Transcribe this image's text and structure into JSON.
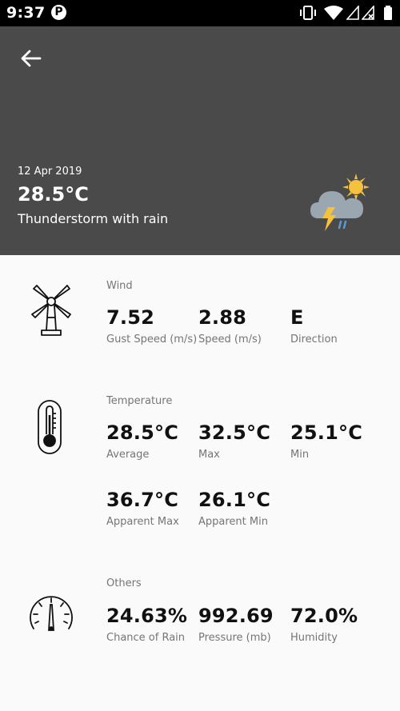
{
  "status_bar": {
    "time": "9:37",
    "app_icon_letter": "P"
  },
  "header": {
    "date": "12 Apr 2019",
    "temperature": "28.5°C",
    "description": "Thunderstorm with rain",
    "weather_icon": "thunderstorm-rain-sun-icon",
    "background_color": "#4a4a4a"
  },
  "wind": {
    "title": "Wind",
    "icon": "windmill-icon",
    "stats": [
      {
        "value": "7.52",
        "label": "Gust Speed (m/s)"
      },
      {
        "value": "2.88",
        "label": "Speed (m/s)"
      },
      {
        "value": "E",
        "label": "Direction"
      }
    ]
  },
  "temperature": {
    "title": "Temperature",
    "icon": "thermometer-icon",
    "stats": [
      {
        "value": "28.5°C",
        "label": "Average"
      },
      {
        "value": "32.5°C",
        "label": "Max"
      },
      {
        "value": "25.1°C",
        "label": "Min"
      },
      {
        "value": "36.7°C",
        "label": "Apparent Max"
      },
      {
        "value": "26.1°C",
        "label": "Apparent Min"
      }
    ]
  },
  "others": {
    "title": "Others",
    "icon": "gauge-icon",
    "stats": [
      {
        "value": "24.63%",
        "label": "Chance of Rain"
      },
      {
        "value": "992.69",
        "label": "Pressure (mb)"
      },
      {
        "value": "72.0%",
        "label": "Humidity"
      }
    ]
  }
}
